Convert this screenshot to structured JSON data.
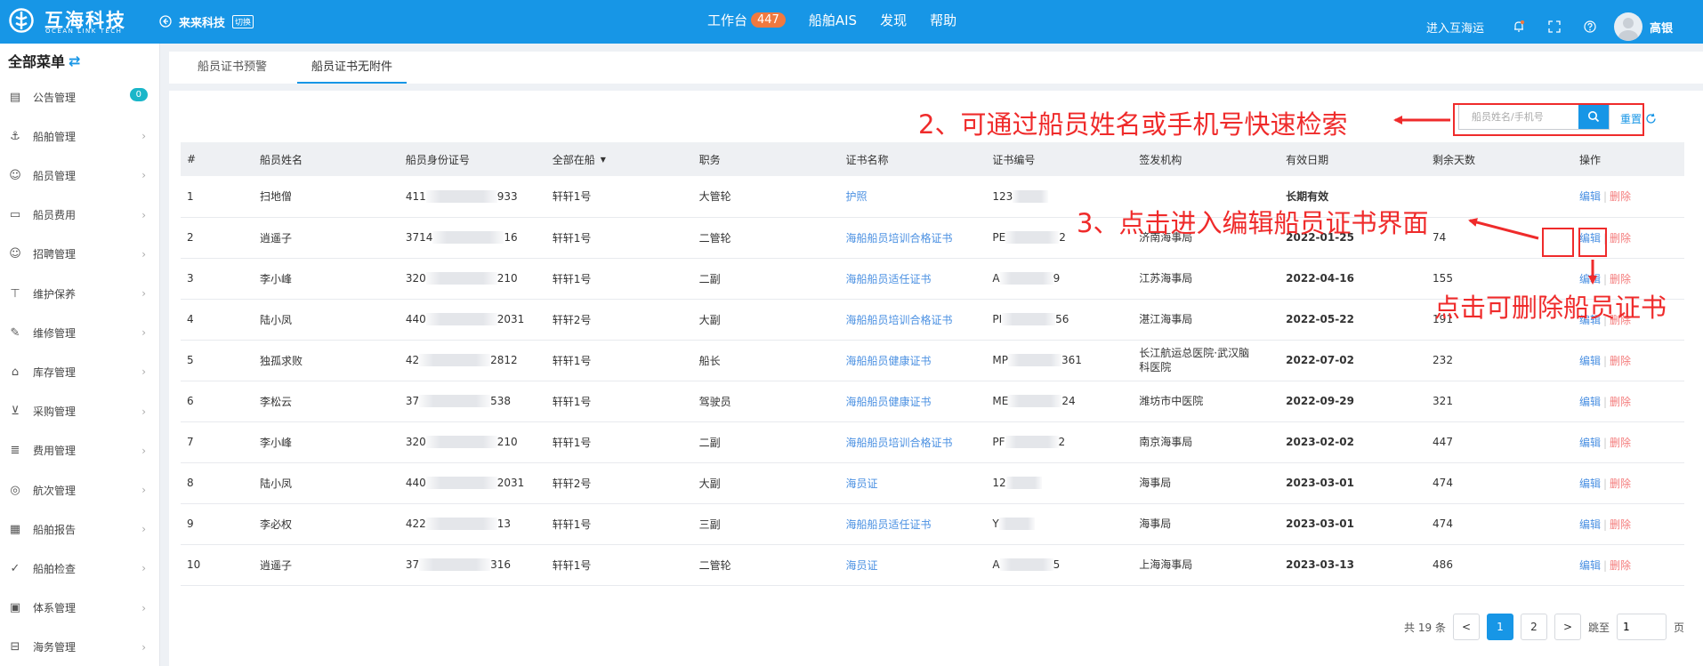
{
  "header": {
    "logo_cn": "互海科技",
    "logo_en": "OCEAN LINK TECH",
    "company": "来来科技",
    "switch": "切换",
    "nav": [
      {
        "label": "工作台",
        "badge": "447"
      },
      {
        "label": "船舶AIS"
      },
      {
        "label": "发现"
      },
      {
        "label": "帮助"
      }
    ],
    "enter_label": "进入互海运",
    "username": "高银"
  },
  "sidebar": {
    "title": "全部菜单",
    "items": [
      {
        "label": "公告管理",
        "icon": "notice-icon",
        "badge": "0"
      },
      {
        "label": "船舶管理",
        "icon": "anchor-icon"
      },
      {
        "label": "船员管理",
        "icon": "user-icon"
      },
      {
        "label": "船员费用",
        "icon": "wallet-icon"
      },
      {
        "label": "招聘管理",
        "icon": "recruit-icon"
      },
      {
        "label": "维护保养",
        "icon": "maintenance-icon"
      },
      {
        "label": "维修管理",
        "icon": "wrench-icon"
      },
      {
        "label": "库存管理",
        "icon": "warehouse-icon"
      },
      {
        "label": "采购管理",
        "icon": "cart-icon"
      },
      {
        "label": "费用管理",
        "icon": "database-icon"
      },
      {
        "label": "航次管理",
        "icon": "globe-icon"
      },
      {
        "label": "船舶报告",
        "icon": "report-icon"
      },
      {
        "label": "船舶检查",
        "icon": "check-icon"
      },
      {
        "label": "体系管理",
        "icon": "system-icon"
      },
      {
        "label": "海务管理",
        "icon": "marine-icon"
      }
    ]
  },
  "tabs": [
    {
      "label": "船员证书预警"
    },
    {
      "label": "船员证书无附件"
    }
  ],
  "search": {
    "placeholder": "船员姓名/手机号",
    "reset_label": "重置"
  },
  "table": {
    "headers": [
      "#",
      "船员姓名",
      "船员身份证号",
      "全部在船",
      "职务",
      "证书名称",
      "证书编号",
      "签发机构",
      "有效日期",
      "剩余天数",
      "操作"
    ],
    "rows": [
      {
        "idx": "1",
        "name": "扫地僧",
        "id_pre": "411",
        "id_suf": "933",
        "ship": "轩轩1号",
        "duty": "大管轮",
        "cert": "护照",
        "no_pre": "123",
        "no_suf": "",
        "org": "",
        "date": "长期有效",
        "days": ""
      },
      {
        "idx": "2",
        "name": "逍遥子",
        "id_pre": "3714",
        "id_suf": "16",
        "ship": "轩轩1号",
        "duty": "二管轮",
        "cert": "海船船员培训合格证书",
        "no_pre": "PE",
        "no_suf": "2",
        "org": "济南海事局",
        "date": "2022-01-25",
        "days": "74"
      },
      {
        "idx": "3",
        "name": "李小峰",
        "id_pre": "320",
        "id_suf": "210",
        "ship": "轩轩1号",
        "duty": "二副",
        "cert": "海船船员适任证书",
        "no_pre": "A",
        "no_suf": "9",
        "org": "江苏海事局",
        "date": "2022-04-16",
        "days": "155"
      },
      {
        "idx": "4",
        "name": "陆小凤",
        "id_pre": "440",
        "id_suf": "2031",
        "ship": "轩轩2号",
        "duty": "大副",
        "cert": "海船船员培训合格证书",
        "no_pre": "PI",
        "no_suf": "56",
        "org": "湛江海事局",
        "date": "2022-05-22",
        "days": "191"
      },
      {
        "idx": "5",
        "name": "独孤求败",
        "id_pre": "42",
        "id_suf": "2812",
        "ship": "轩轩1号",
        "duty": "船长",
        "cert": "海船船员健康证书",
        "no_pre": "MP",
        "no_suf": "361",
        "org": "长江航运总医院·武汉脑科医院",
        "date": "2022-07-02",
        "days": "232"
      },
      {
        "idx": "6",
        "name": "李松云",
        "id_pre": "37",
        "id_suf": "538",
        "ship": "轩轩1号",
        "duty": "驾驶员",
        "cert": "海船船员健康证书",
        "no_pre": "ME",
        "no_suf": "24",
        "org": "潍坊市中医院",
        "date": "2022-09-29",
        "days": "321"
      },
      {
        "idx": "7",
        "name": "李小峰",
        "id_pre": "320",
        "id_suf": "210",
        "ship": "轩轩1号",
        "duty": "二副",
        "cert": "海船船员培训合格证书",
        "no_pre": "PF",
        "no_suf": "2",
        "org": "南京海事局",
        "date": "2023-02-02",
        "days": "447"
      },
      {
        "idx": "8",
        "name": "陆小凤",
        "id_pre": "440",
        "id_suf": "2031",
        "ship": "轩轩2号",
        "duty": "大副",
        "cert": "海员证",
        "no_pre": "12",
        "no_suf": "",
        "org": "海事局",
        "date": "2023-03-01",
        "days": "474"
      },
      {
        "idx": "9",
        "name": "李必权",
        "id_pre": "422",
        "id_suf": "13",
        "ship": "轩轩1号",
        "duty": "三副",
        "cert": "海船船员适任证书",
        "no_pre": "Y",
        "no_suf": "",
        "org": "海事局",
        "date": "2023-03-01",
        "days": "474"
      },
      {
        "idx": "10",
        "name": "逍遥子",
        "id_pre": "37",
        "id_suf": "316",
        "ship": "轩轩1号",
        "duty": "二管轮",
        "cert": "海员证",
        "no_pre": "A",
        "no_suf": "5",
        "org": "上海海事局",
        "date": "2023-03-13",
        "days": "486"
      }
    ],
    "edit_label": "编辑",
    "delete_label": "删除"
  },
  "pagination": {
    "total_prefix": "共",
    "total": "19",
    "total_suffix": "条",
    "prev": "<",
    "pages": [
      "1",
      "2"
    ],
    "current_page": "1",
    "next": ">",
    "jump_prefix": "跳至",
    "jump_value": "1",
    "jump_suffix": "页"
  },
  "annotations": {
    "search_tip": "2、可通过船员姓名或手机号快速检索",
    "edit_tip": "3、点击进入编辑船员证书界面",
    "delete_tip": "点击可删除船员证书"
  },
  "colors": {
    "primary": "#1796e6",
    "annotation": "#ef2b2b",
    "delete": "#f47c7c",
    "link": "#4a90e2"
  }
}
